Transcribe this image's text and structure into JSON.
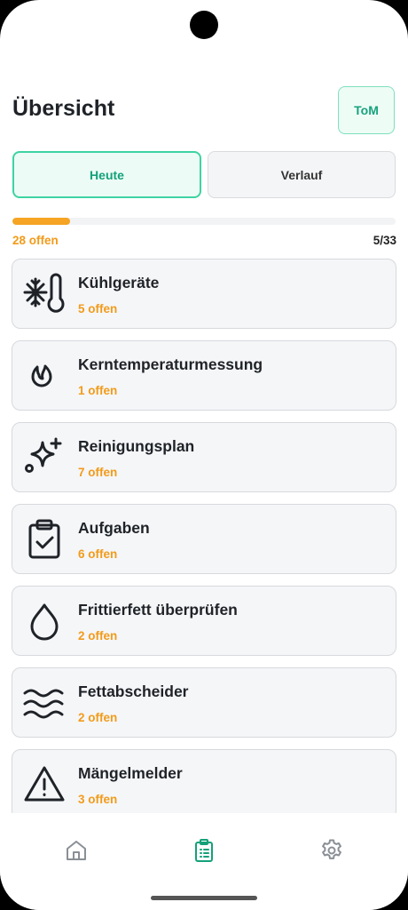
{
  "header": {
    "title": "Übersicht",
    "user_initials": "ToM"
  },
  "tabs": [
    {
      "label": "Heute",
      "active": true
    },
    {
      "label": "Verlauf",
      "active": false
    }
  ],
  "progress": {
    "open_label": "28 offen",
    "count_label": "5/33",
    "fraction": 0.15,
    "color": "#f5a423"
  },
  "categories": [
    {
      "name": "Kühlgeräte",
      "status": "5 offen",
      "icon": "thermometer-snowflake-icon"
    },
    {
      "name": "Kerntemperaturmessung",
      "status": "1 offen",
      "icon": "flame-icon"
    },
    {
      "name": "Reinigungsplan",
      "status": "7 offen",
      "icon": "sparkles-icon"
    },
    {
      "name": "Aufgaben",
      "status": "6 offen",
      "icon": "clipboard-check-icon"
    },
    {
      "name": "Frittierfett überprüfen",
      "status": "2 offen",
      "icon": "droplet-icon"
    },
    {
      "name": "Fettabscheider",
      "status": "2 offen",
      "icon": "waves-icon"
    },
    {
      "name": "Mängelmelder",
      "status": "3 offen",
      "icon": "alert-triangle-icon"
    }
  ],
  "bottom_nav": [
    {
      "icon": "home-icon",
      "active": false
    },
    {
      "icon": "clipboard-list-icon",
      "active": true
    },
    {
      "icon": "settings-gear-icon",
      "active": false
    }
  ],
  "colors": {
    "accent": "#16a37c",
    "warning": "#f29b1a"
  }
}
